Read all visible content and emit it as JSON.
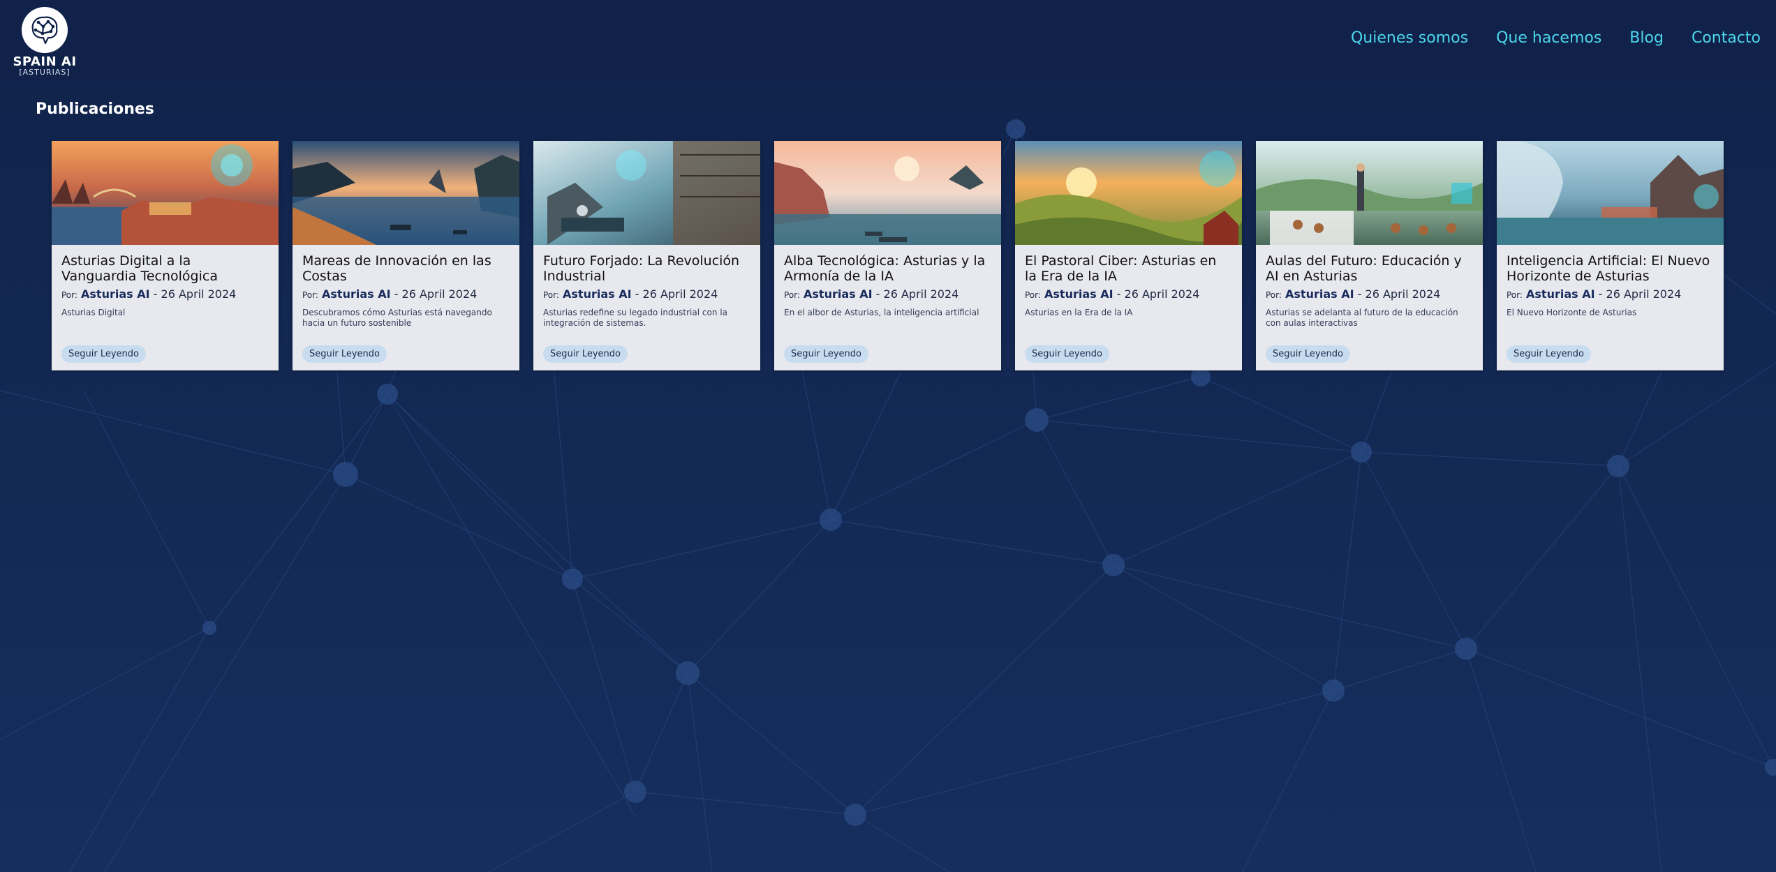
{
  "brand": {
    "name": "SPAIN AI",
    "sub": "[ASTURIAS]"
  },
  "nav": {
    "items": [
      {
        "label": "Quienes somos"
      },
      {
        "label": "Que hacemos"
      },
      {
        "label": "Blog"
      },
      {
        "label": "Contacto"
      }
    ]
  },
  "colors": {
    "background": "#10224a",
    "nav_link": "#4dd6ec",
    "card_bg": "#e8e9ef",
    "button_bg": "#c8dcf0"
  },
  "main": {
    "section_title": "Publicaciones",
    "posts": [
      {
        "title": "Asturias Digital a la Vanguardia Tecnológica",
        "por": "Por:",
        "author": "Asturias AI",
        "date": "- 26 April 2024",
        "excerpt": "Asturias Digital",
        "button": "Seguir Leyendo",
        "image_theme": "city-dusk"
      },
      {
        "title": "Mareas de Innovación en las Costas",
        "por": "Por:",
        "author": "Asturias AI",
        "date": "- 26 April 2024",
        "excerpt": "Descubramos cómo Asturias está navegando hacia un futuro sostenible",
        "button": "Seguir Leyendo",
        "image_theme": "coast-sunset"
      },
      {
        "title": "Futuro Forjado: La Revolución Industrial",
        "por": "Por:",
        "author": "Asturias AI",
        "date": "- 26 April 2024",
        "excerpt": "Asturias redefine su legado industrial con la integración de sistemas.",
        "button": "Seguir Leyendo",
        "image_theme": "industrial"
      },
      {
        "title": "Alba Tecnológica: Asturias y la Armonía de la IA",
        "por": "Por:",
        "author": "Asturias AI",
        "date": "- 26 April 2024",
        "excerpt": "En el albor de Asturias, la inteligencia artificial",
        "button": "Seguir Leyendo",
        "image_theme": "misty-dawn"
      },
      {
        "title": "El Pastoral Ciber: Asturias en la Era de la IA",
        "por": "Por:",
        "author": "Asturias AI",
        "date": "- 26 April 2024",
        "excerpt": "Asturias en la Era de la IA",
        "button": "Seguir Leyendo",
        "image_theme": "pastoral"
      },
      {
        "title": "Aulas del Futuro: Educación y AI en Asturias",
        "por": "Por:",
        "author": "Asturias AI",
        "date": "- 26 April 2024",
        "excerpt": "Asturias se adelanta al futuro de la educación con aulas interactivas",
        "button": "Seguir Leyendo",
        "image_theme": "classroom"
      },
      {
        "title": "Inteligencia Artificial: El Nuevo Horizonte de Asturias",
        "por": "Por:",
        "author": "Asturias AI",
        "date": "- 26 April 2024",
        "excerpt": "El Nuevo Horizonte de Asturias",
        "button": "Seguir Leyendo",
        "image_theme": "ai-face"
      }
    ]
  }
}
